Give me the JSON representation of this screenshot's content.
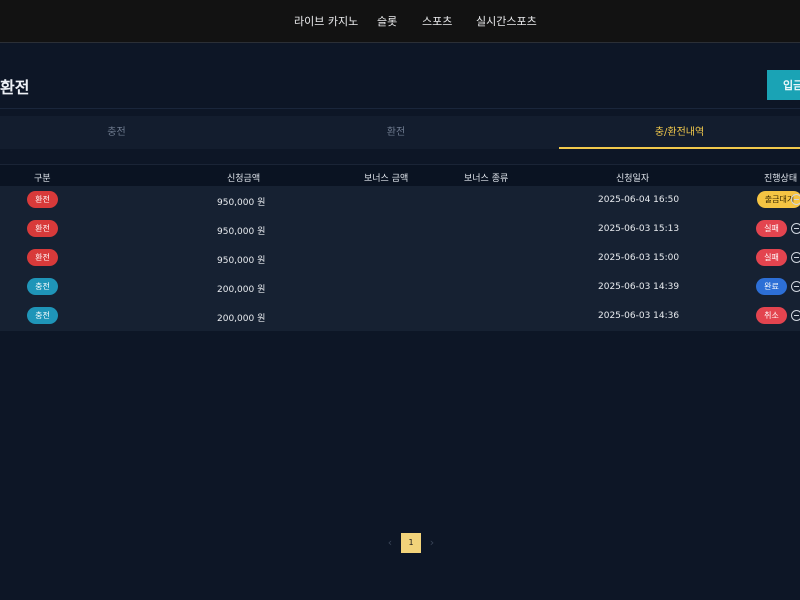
{
  "nav": {
    "items": [
      "라이브 카지노",
      "슬롯",
      "스포츠",
      "실시간스포츠"
    ]
  },
  "page": {
    "title": "환전",
    "deposit_label": "입금"
  },
  "tabs": [
    {
      "label": "충전",
      "active": false
    },
    {
      "label": "환전",
      "active": false
    },
    {
      "label": "충/환전내역",
      "active": true
    }
  ],
  "table": {
    "headers": {
      "type": "구분",
      "amount": "신청금액",
      "bonus_amount": "보너스 금액",
      "bonus_type": "보너스 종류",
      "date": "신청일자",
      "status": "진행상태"
    },
    "rows": [
      {
        "type": "환전",
        "amount": "950,000 원",
        "date": "2025-06-04 16:50",
        "status": "출금대기"
      },
      {
        "type": "환전",
        "amount": "950,000 원",
        "date": "2025-06-03 15:13",
        "status": "실패"
      },
      {
        "type": "환전",
        "amount": "950,000 원",
        "date": "2025-06-03 15:00",
        "status": "실패"
      },
      {
        "type": "충전",
        "amount": "200,000 원",
        "date": "2025-06-03 14:39",
        "status": "완료"
      },
      {
        "type": "충전",
        "amount": "200,000 원",
        "date": "2025-06-03 14:36",
        "status": "취소"
      }
    ]
  },
  "pagination": {
    "prev": "‹",
    "current": "1",
    "next": "›"
  },
  "colors": {
    "withdraw_badge": "#d83a3a",
    "deposit_badge": "#1f95b8",
    "status_pending": "#f5c443",
    "status_failed": "#e3444f",
    "status_done": "#2d6fd6",
    "status_cancel": "#e3444f",
    "accent": "#f2c94c"
  },
  "icons": {
    "row_action": "minus-circle-icon"
  }
}
